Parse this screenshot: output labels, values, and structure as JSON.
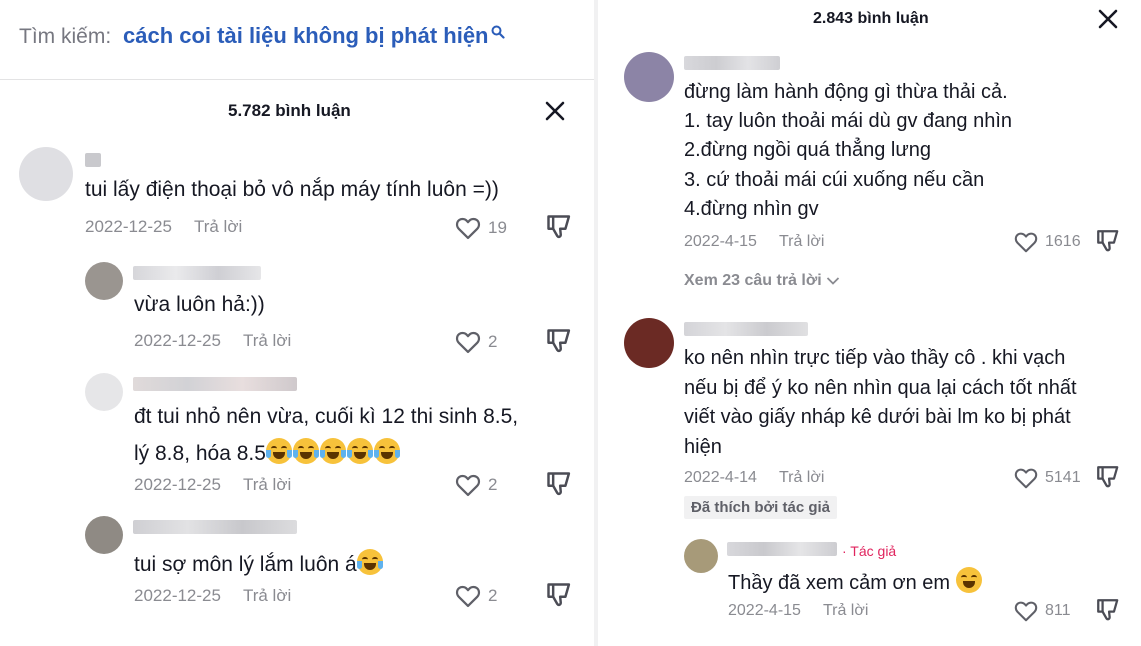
{
  "left": {
    "search": {
      "label": "Tìm kiếm:",
      "query": "cách coi tài liệu không bị phát hiện"
    },
    "comment_count": "5.782 bình luận",
    "comments": [
      {
        "text": "tui lấy điện thoại bỏ vô nắp máy tính luôn =))",
        "date": "2022-12-25",
        "reply": "Trả lời",
        "likes": "19"
      },
      {
        "text": "vừa luôn hả:))",
        "date": "2022-12-25",
        "reply": "Trả lời",
        "likes": "2"
      },
      {
        "text_lines": [
          "đt tui nhỏ nên vừa, cuối kì 12 thi sinh 8.5,",
          "lý 8.8, hóa 8.5"
        ],
        "date": "2022-12-25",
        "reply": "Trả lời",
        "likes": "2"
      },
      {
        "text": "tui sợ môn lý lắm luôn á",
        "date": "2022-12-25",
        "reply": "Trả lời",
        "likes": "2"
      }
    ]
  },
  "right": {
    "comment_count": "2.843 bình luận",
    "comments": [
      {
        "lines": [
          "đừng làm hành động gì thừa thải cả.",
          "1. tay luôn thoải mái dù gv đang nhìn",
          "2.đừng ngồi quá thẳng lưng",
          "3. cứ thoải mái cúi xuống nếu cần",
          "4.đừng nhìn gv"
        ],
        "date": "2022-4-15",
        "reply": "Trả lời",
        "likes": "1616",
        "more": "Xem 23 câu trả lời"
      },
      {
        "lines": [
          "ko nên nhìn trực tiếp vào thầy cô . khi vạch",
          "nếu bị để ý ko nên nhìn qua lại cách tốt nhất",
          "viết vào giấy nháp kê dưới bài lm ko bị phát",
          "hiện"
        ],
        "date": "2022-4-14",
        "reply": "Trả lời",
        "likes": "5141",
        "badge": "Đã thích bởi tác giả"
      },
      {
        "author_tag": "· Tác giả",
        "text": "Thầy đã xem cảm ơn em",
        "date": "2022-4-15",
        "reply": "Trả lời",
        "likes": "811"
      }
    ]
  },
  "icons": [
    "search-icon",
    "close-icon",
    "heart-icon",
    "dislike-icon",
    "chevron-down-icon"
  ],
  "colors": {
    "search_query": "#2b5db9",
    "meta": "#8a8b91",
    "author_tag": "#e0245e"
  }
}
